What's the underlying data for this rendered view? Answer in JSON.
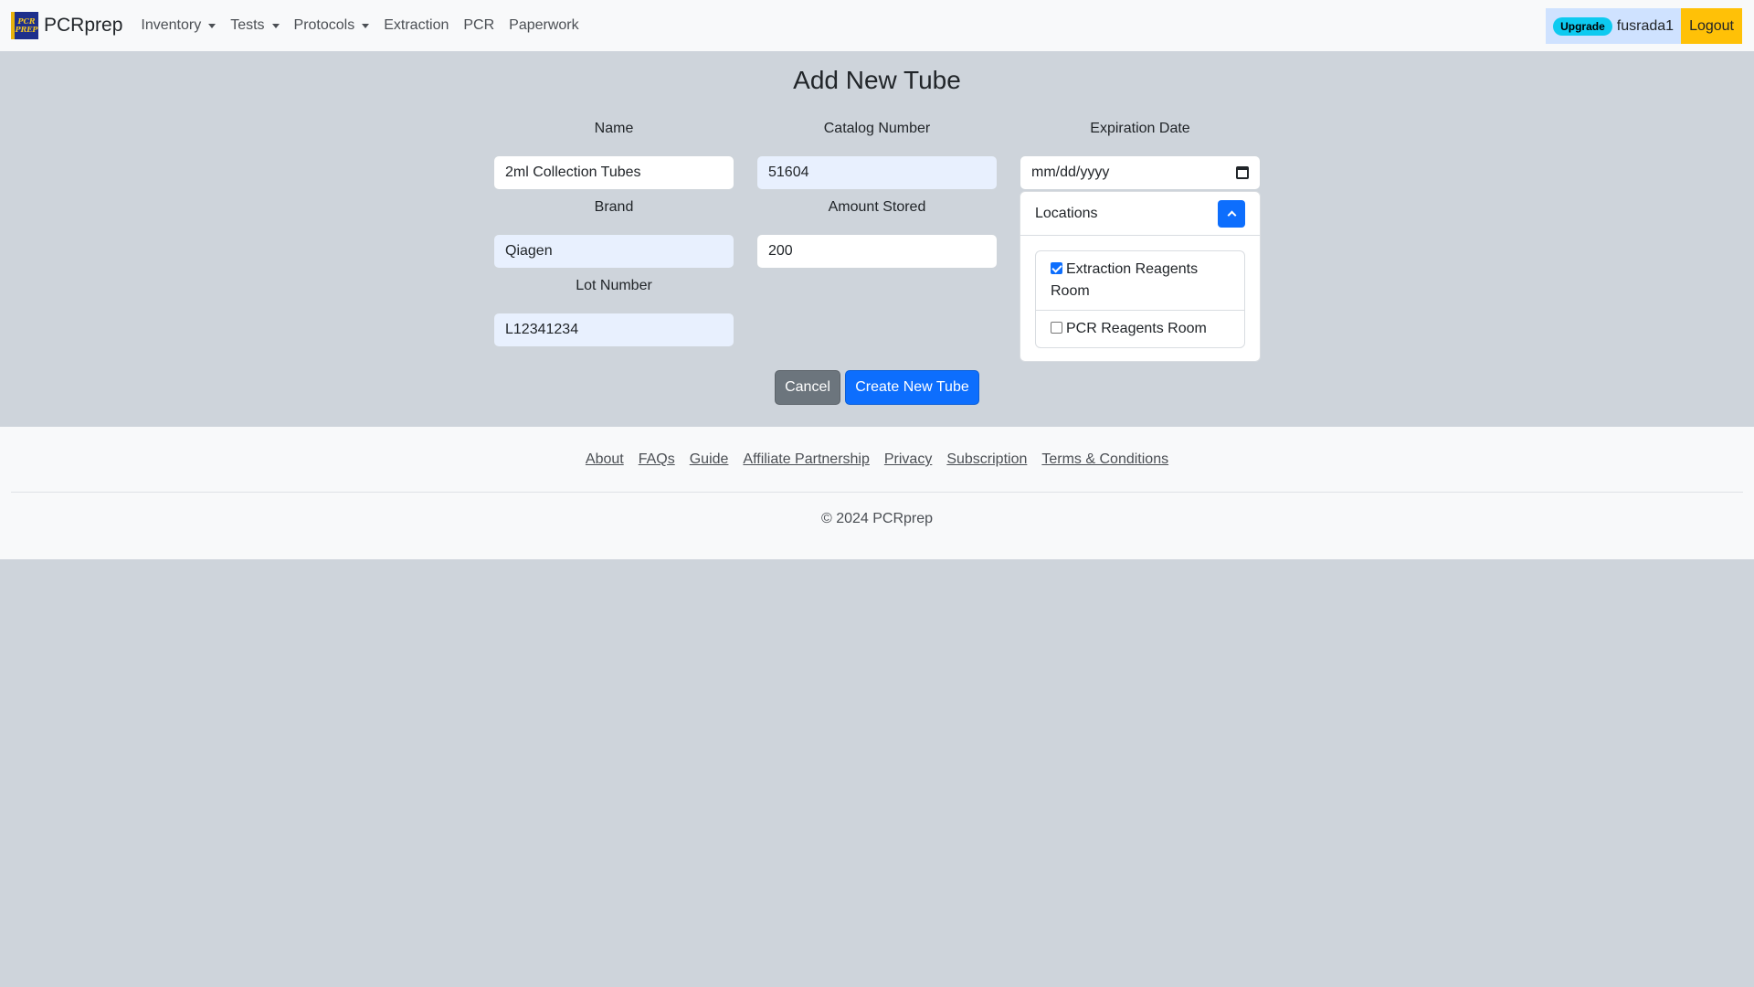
{
  "navbar": {
    "logo_text": "PCR PREP",
    "brand": "PCRprep",
    "items": [
      {
        "label": "Inventory",
        "dropdown": true
      },
      {
        "label": "Tests",
        "dropdown": true
      },
      {
        "label": "Protocols",
        "dropdown": true
      },
      {
        "label": "Extraction",
        "dropdown": false
      },
      {
        "label": "PCR",
        "dropdown": false
      },
      {
        "label": "Paperwork",
        "dropdown": false
      }
    ],
    "upgrade_badge": "Upgrade",
    "username": "fusrada1",
    "logout": "Logout"
  },
  "form": {
    "title": "Add New Tube",
    "name": {
      "label": "Name",
      "value": "2ml Collection Tubes"
    },
    "catalog_number": {
      "label": "Catalog Number",
      "value": "51604"
    },
    "expiration_date": {
      "label": "Expiration Date",
      "value": "mm/dd/yyyy"
    },
    "brand": {
      "label": "Brand",
      "value": "Qiagen"
    },
    "amount_stored": {
      "label": "Amount Stored",
      "value": "200"
    },
    "lot_number": {
      "label": "Lot Number",
      "value": "L12341234"
    },
    "locations": {
      "title": "Locations",
      "items": [
        {
          "label": "Extraction Reagents Room",
          "checked": true
        },
        {
          "label": "PCR Reagents Room",
          "checked": false
        }
      ]
    },
    "cancel_label": "Cancel",
    "submit_label": "Create New Tube"
  },
  "footer": {
    "links": [
      "About",
      "FAQs",
      "Guide",
      "Affiliate Partnership",
      "Privacy",
      "Subscription",
      "Terms & Conditions"
    ],
    "copyright": "© 2024 PCRprep"
  },
  "colors": {
    "primary": "#0d6efd",
    "secondary": "#6c757d",
    "warning": "#ffc107",
    "info": "#0dcaf0",
    "page_background": "#ced4db"
  }
}
